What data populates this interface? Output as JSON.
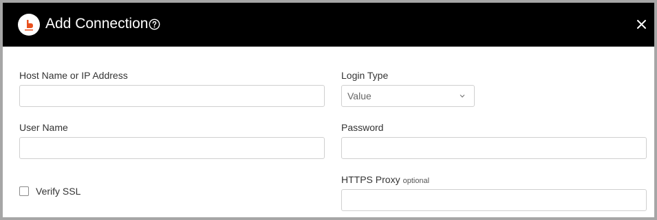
{
  "dialog": {
    "title": "Add Connection",
    "icons": {
      "logo": "brand-logo-icon",
      "help": "help-circle-icon",
      "close": "close-icon"
    },
    "colors": {
      "header_bg": "#000000",
      "brand": "#e8501e"
    }
  },
  "form": {
    "host": {
      "label": "Host Name or IP Address",
      "value": ""
    },
    "login_type": {
      "label": "Login Type",
      "value": "Value"
    },
    "user": {
      "label": "User Name",
      "value": ""
    },
    "password": {
      "label": "Password",
      "value": ""
    },
    "verify_ssl": {
      "label": "Verify SSL",
      "checked": false
    },
    "https_proxy": {
      "label": "HTTPS Proxy",
      "optional": "optional",
      "value": ""
    }
  }
}
